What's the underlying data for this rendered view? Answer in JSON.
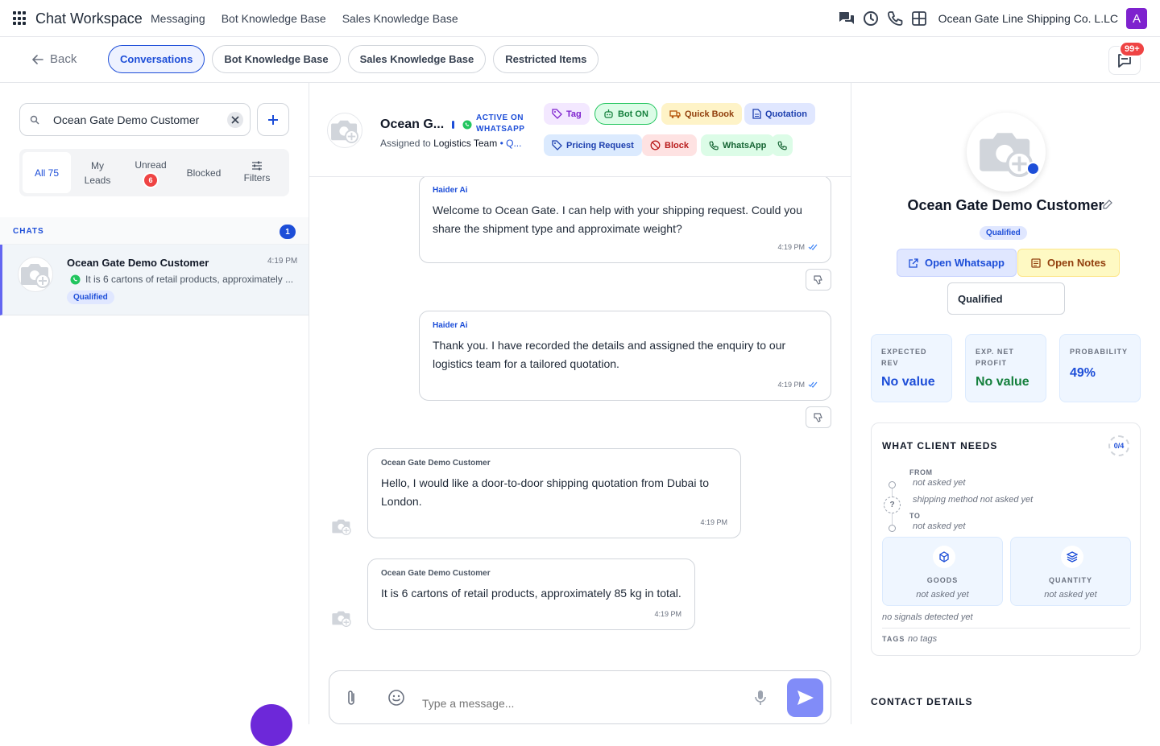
{
  "topbar": {
    "app_title": "Chat Workspace",
    "nav": [
      "Messaging",
      "Bot Knowledge Base",
      "Sales Knowledge Base"
    ],
    "company": "Ocean Gate Line Shipping Co. L.LC",
    "user_initial": "A",
    "icons": [
      "chats-icon",
      "clock-icon",
      "phone-icon",
      "grid-icon"
    ]
  },
  "subbar": {
    "back_label": "Back",
    "tabs": [
      "Conversations",
      "Bot Knowledge Base",
      "Sales Knowledge Base",
      "Restricted Items"
    ],
    "active_tab": "Conversations",
    "inbox_badge": "99+"
  },
  "sidebar": {
    "search_value": "Ocean Gate Demo Customer",
    "filters": [
      {
        "label": "All 75"
      },
      {
        "label": "My Leads"
      },
      {
        "label": "Unread",
        "count": "6"
      },
      {
        "label": "Blocked"
      },
      {
        "label": "Filters"
      }
    ],
    "chats_label": "CHATS",
    "chats_count": "1",
    "chat": {
      "name": "Ocean Gate Demo Customer",
      "time": "4:19 PM",
      "preview": "It is 6 cartons of retail products, approximately ...",
      "badge": "Qualified"
    }
  },
  "chat_header": {
    "name": "Ocean G...",
    "status": "ACTIVE ON WHATSAPP",
    "assigned_prefix": "Assigned to",
    "assigned_team": "Logistics Team",
    "assigned_more": "Q...",
    "actions": {
      "tag": "Tag",
      "bot": "Bot ON",
      "quick_book": "Quick Book",
      "quotation": "Quotation",
      "pricing_request": "Pricing Request",
      "block": "Block",
      "whatsapp": "WhatsApp"
    }
  },
  "messages": [
    {
      "sender": "Haider Ai",
      "text": "Welcome to Ocean Gate. I can help with your shipping request. Could you share the shipment type and approximate weight?",
      "time": "4:19 PM"
    },
    {
      "sender": "Haider Ai",
      "text": "Thank you. I have recorded the details and assigned the enquiry to our logistics team for a tailored quotation.",
      "time": "4:19 PM"
    },
    {
      "sender": "Ocean Gate Demo Customer",
      "text": "Hello, I would like a door-to-door shipping quotation from Dubai to London.",
      "time": "4:19 PM"
    },
    {
      "sender": "Ocean Gate Demo Customer",
      "text": "It is 6 cartons of retail products, approximately 85 kg in total.",
      "time": "4:19 PM"
    }
  ],
  "composer": {
    "placeholder": "Type a message..."
  },
  "profile": {
    "name": "Ocean Gate Demo Customer",
    "badge": "Qualified",
    "open_whatsapp": "Open Whatsapp",
    "open_notes": "Open Notes",
    "stage": "Qualified",
    "kpis": [
      {
        "label": "EXPECTED REV",
        "value": "No value",
        "color": "#1d4ed8"
      },
      {
        "label": "EXP. NET PROFIT",
        "value": "No value",
        "color": "#15803d"
      },
      {
        "label": "PROBABILITY",
        "value": "49%",
        "color": "#1d4ed8"
      }
    ],
    "needs": {
      "title": "WHAT CLIENT NEEDS",
      "progress": "0/4",
      "from_label": "FROM",
      "from_value": "not asked yet",
      "method_value": "shipping method not asked yet",
      "to_label": "TO",
      "to_value": "not asked yet",
      "goods_label": "GOODS",
      "goods_value": "not asked yet",
      "quantity_label": "QUANTITY",
      "quantity_value": "not asked yet",
      "signals": "no signals detected yet",
      "tags_label": "TAGS",
      "tags_value": "no tags"
    },
    "contact_details_label": "CONTACT DETAILS"
  }
}
